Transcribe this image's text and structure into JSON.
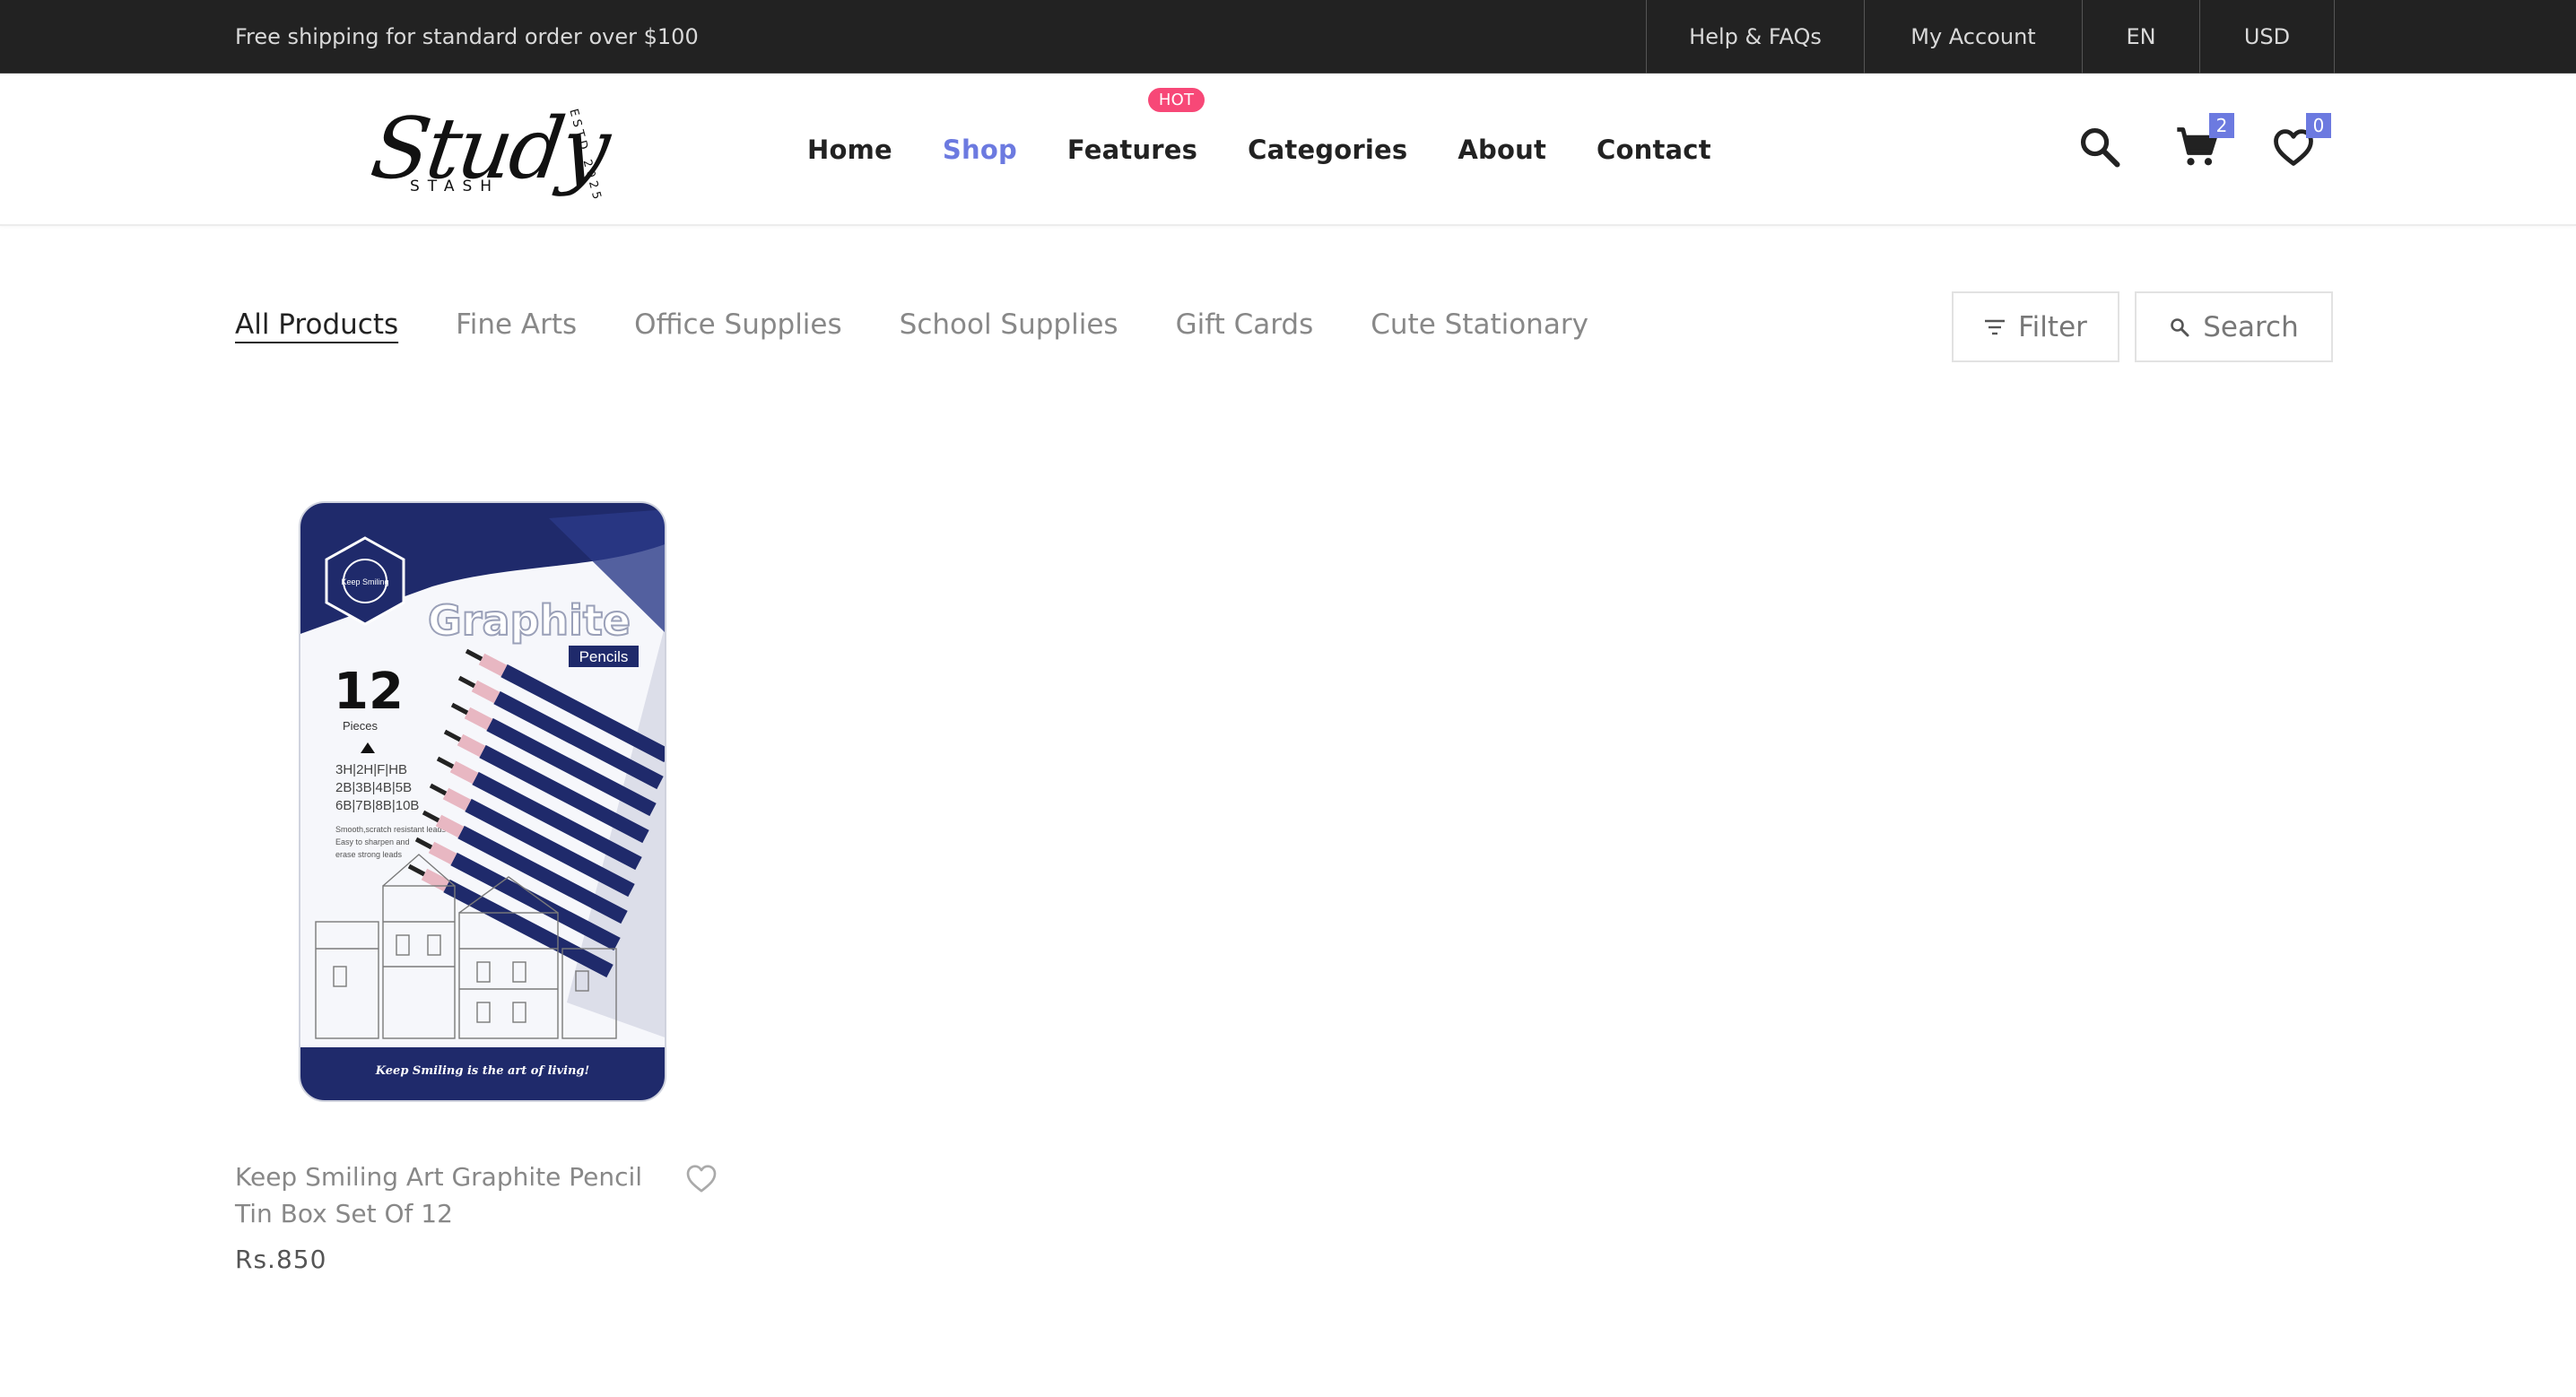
{
  "topbar": {
    "shipping_text": "Free shipping for standard order over $100",
    "links": [
      "Help & FAQs",
      "My Account",
      "EN",
      "USD"
    ]
  },
  "logo": {
    "script_text": "Study",
    "sub_text": "STASH",
    "estd_text": "ESTD 2025"
  },
  "nav": {
    "items": [
      "Home",
      "Shop",
      "Features",
      "Categories",
      "About",
      "Contact"
    ],
    "active": "Shop",
    "hot_badge": "HOT"
  },
  "header_icons": {
    "search": "search-icon",
    "cart": "cart-icon",
    "wishlist": "heart-icon",
    "cart_count": "2",
    "wishlist_count": "0"
  },
  "categories": {
    "items": [
      "All Products",
      "Fine Arts",
      "Office Supplies",
      "School Supplies",
      "Gift Cards",
      "Cute Stationary"
    ],
    "active": "All Products"
  },
  "toolbar": {
    "filter_label": "Filter",
    "search_label": "Search"
  },
  "products": [
    {
      "name": "Keep Smiling Art Graphite Pencil Tin Box Set Of 12",
      "price": "Rs.850",
      "image": {
        "brand": "Keep Smiling",
        "title": "Graphite",
        "subtitle": "Pencils",
        "count": "12",
        "count_label": "Pieces",
        "grades": [
          "3H|2H|F|HB",
          "2B|3B|4B|5B",
          "6B|7B|8B|10B"
        ],
        "notes": [
          "Smooth,scratch resistant leads",
          "Easy to sharpen and",
          "erase strong leads"
        ],
        "slogan": "Keep Smiling is the art of living!"
      }
    }
  ],
  "colors": {
    "accent": "#6c7ae0",
    "hot": "#f74877",
    "topbar_bg": "#222222",
    "tin_navy": "#1f2a6b"
  }
}
